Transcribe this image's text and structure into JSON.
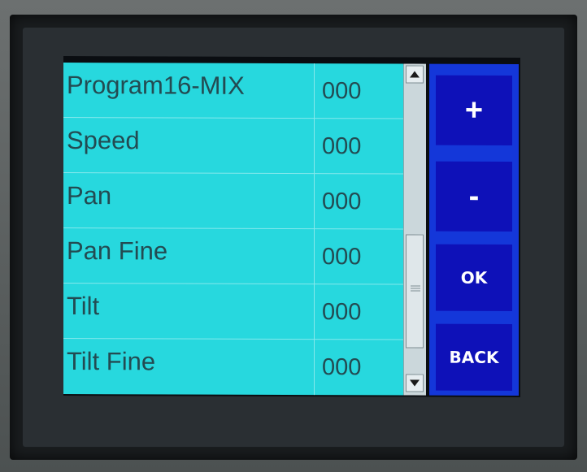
{
  "settings_list": {
    "rows": [
      {
        "label": "Program16-MIX",
        "value": "000"
      },
      {
        "label": "Speed",
        "value": "000"
      },
      {
        "label": "Pan",
        "value": "000"
      },
      {
        "label": "Pan Fine",
        "value": "000"
      },
      {
        "label": "Tilt",
        "value": "000"
      },
      {
        "label": "Tilt Fine",
        "value": "000"
      }
    ]
  },
  "scrollbar": {
    "up_icon": "arrow-up-icon",
    "down_icon": "arrow-down-icon"
  },
  "controls": {
    "increment_label": "+",
    "decrement_label": "-",
    "ok_label": "OK",
    "back_label": "BACK"
  },
  "colors": {
    "list_background": "#27d8de",
    "list_text": "#234b52",
    "panel_background": "#1437d9",
    "button_background": "#0e11b8"
  }
}
